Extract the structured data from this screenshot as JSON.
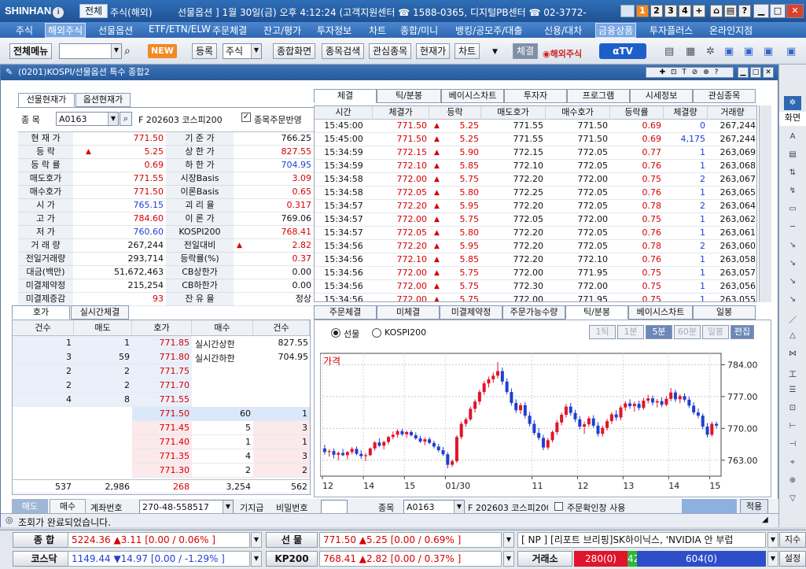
{
  "titlebar": {
    "logo": "SHINHAN",
    "btn_all": "전체",
    "btn_overseas": "주식(해외)",
    "marquee": "선물옵션 ] 1월 30일(금) 오후 4:12:24 (고객지원센터 ☎ 1588-0365, 디지털PB센터 ☎ 02-3772-",
    "nums": [
      "1",
      "2",
      "3",
      "4",
      "+"
    ]
  },
  "menubar": [
    "주식",
    "해외주식",
    "선물옵션",
    "ETF/ETN/ELW",
    "주문체결",
    "잔고/평가",
    "투자정보",
    "차트",
    "종합/미니",
    "뱅킹/공모주/대출",
    "신용/대차",
    "금융상품",
    "투자플러스",
    "온라인지점"
  ],
  "toolbar": {
    "menu_btn": "전체메뉴",
    "new_badge": "NEW",
    "register": "등록",
    "stock_select": "주식",
    "comprehensive": "종합화면",
    "stock_search": "종목검색",
    "interest": "관심종목",
    "current_price": "현재가",
    "chart": "차트",
    "execution": "체결",
    "overseas": "해외주식",
    "atv": "αTV"
  },
  "window": {
    "title": "(0201)KOSPI/선물옵션 특수 종합2"
  },
  "left_top": {
    "tabs": [
      "선물현재가",
      "옵션현재가"
    ],
    "code_label": "종 목",
    "code_value": "A0163",
    "code_name": "F 202603 코스피200",
    "check_label": "종목주문반영",
    "rows": [
      {
        "l1": "현 재 가",
        "v1": "771.50",
        "c1": "red",
        "l2": "기 준 가",
        "v2": "766.25",
        "c2": ""
      },
      {
        "l1": "등    락",
        "v1": "5.25",
        "c1": "red",
        "arrow": "▲",
        "l2": "상 한 가",
        "v2": "827.55",
        "c2": "red"
      },
      {
        "l1": "등 락 률",
        "v1": "0.69",
        "c1": "red",
        "l2": "하 한 가",
        "v2": "704.95",
        "c2": "blue"
      },
      {
        "l1": "매도호가",
        "v1": "771.55",
        "c1": "red",
        "l2": "시장Basis",
        "v2": "3.09",
        "c2": "red"
      },
      {
        "l1": "매수호가",
        "v1": "771.50",
        "c1": "red",
        "l2": "이론Basis",
        "v2": "0.65",
        "c2": "red"
      },
      {
        "l1": "시    가",
        "v1": "765.15",
        "c1": "blue",
        "l2": "괴 리 율",
        "v2": "0.317",
        "c2": "red"
      },
      {
        "l1": "고    가",
        "v1": "784.60",
        "c1": "red",
        "l2": "이 론 가",
        "v2": "769.06",
        "c2": ""
      },
      {
        "l1": "저    가",
        "v1": "760.60",
        "c1": "blue",
        "l2": "KOSPI200",
        "v2": "768.41",
        "c2": "red"
      },
      {
        "l1": "거 래 량",
        "v1": "267,244",
        "c1": "",
        "l2": "전일대비",
        "v2": "2.82",
        "c2": "red",
        "arrow2": "▲"
      },
      {
        "l1": "전일거래량",
        "v1": "293,714",
        "c1": "",
        "l2": "등락률(%)",
        "v2": "0.37",
        "c2": "red"
      },
      {
        "l1": "대금(백만)",
        "v1": "51,672,463",
        "c1": "",
        "l2": "CB상한가",
        "v2": "0.00",
        "c2": ""
      },
      {
        "l1": "미결제약정",
        "v1": "215,254",
        "c1": "",
        "l2": "CB하한가",
        "v2": "0.00",
        "c2": ""
      },
      {
        "l1": "미결제증감",
        "v1": "93",
        "c1": "red",
        "l2": "잔 유 율",
        "v2": "정상",
        "c2": ""
      }
    ]
  },
  "right_top": {
    "tabs": [
      "체결",
      "틱/분봉",
      "베이시스차트",
      "투자자",
      "프로그램",
      "시세정보",
      "관심종목"
    ],
    "headers": [
      "시간",
      "체결가",
      "등락",
      "매도호가",
      "매수호가",
      "등락률",
      "체결량",
      "거래량"
    ],
    "rows": [
      [
        "15:45:00",
        "771.50",
        "5.25",
        "771.55",
        "771.50",
        "0.69",
        "0",
        "267,244"
      ],
      [
        "15:45:00",
        "771.50",
        "5.25",
        "771.55",
        "771.50",
        "0.69",
        "4,175",
        "267,244"
      ],
      [
        "15:34:59",
        "772.15",
        "5.90",
        "772.15",
        "772.05",
        "0.77",
        "1",
        "263,069"
      ],
      [
        "15:34:59",
        "772.10",
        "5.85",
        "772.10",
        "772.05",
        "0.76",
        "1",
        "263,068"
      ],
      [
        "15:34:58",
        "772.00",
        "5.75",
        "772.20",
        "772.00",
        "0.75",
        "2",
        "263,067"
      ],
      [
        "15:34:58",
        "772.05",
        "5.80",
        "772.25",
        "772.05",
        "0.76",
        "1",
        "263,065"
      ],
      [
        "15:34:57",
        "772.20",
        "5.95",
        "772.20",
        "772.05",
        "0.78",
        "2",
        "263,064"
      ],
      [
        "15:34:57",
        "772.00",
        "5.75",
        "772.05",
        "772.00",
        "0.75",
        "1",
        "263,062"
      ],
      [
        "15:34:57",
        "772.05",
        "5.80",
        "772.20",
        "772.05",
        "0.76",
        "1",
        "263,061"
      ],
      [
        "15:34:56",
        "772.20",
        "5.95",
        "772.20",
        "772.05",
        "0.78",
        "2",
        "263,060"
      ],
      [
        "15:34:56",
        "772.10",
        "5.85",
        "772.20",
        "772.10",
        "0.76",
        "1",
        "263,058"
      ],
      [
        "15:34:56",
        "772.00",
        "5.75",
        "772.00",
        "771.95",
        "0.75",
        "1",
        "263,057"
      ],
      [
        "15:34:56",
        "772.00",
        "5.75",
        "772.30",
        "772.00",
        "0.75",
        "1",
        "263,056"
      ],
      [
        "15:34:56",
        "772.00",
        "5.75",
        "772.00",
        "771.95",
        "0.75",
        "1",
        "263,055"
      ]
    ]
  },
  "orderbook": {
    "tabs": [
      "호가",
      "실시간체결"
    ],
    "headers": [
      "건수",
      "매도",
      "호가",
      "매수",
      "건수"
    ],
    "asks": [
      {
        "cnt": "1",
        "qty": "1",
        "price": "771.85"
      },
      {
        "cnt": "3",
        "qty": "59",
        "price": "771.80"
      },
      {
        "cnt": "2",
        "qty": "2",
        "price": "771.75"
      },
      {
        "cnt": "2",
        "qty": "2",
        "price": "771.70"
      },
      {
        "cnt": "4",
        "qty": "8",
        "price": "771.55"
      }
    ],
    "upper_label": "실시간상한",
    "upper_val": "827.55",
    "lower_label": "실시간하한",
    "lower_val": "704.95",
    "bids": [
      {
        "price": "771.50",
        "qty": "60",
        "cnt": "1"
      },
      {
        "price": "771.45",
        "qty": "5",
        "cnt": "3"
      },
      {
        "price": "771.40",
        "qty": "1",
        "cnt": "1"
      },
      {
        "price": "771.35",
        "qty": "4",
        "cnt": "3"
      },
      {
        "price": "771.30",
        "qty": "2",
        "cnt": "2"
      }
    ],
    "totals": {
      "ask_cnt": "537",
      "ask_qty": "2,986",
      "diff": "268",
      "bid_qty": "3,254",
      "bid_cnt": "562"
    }
  },
  "order_strip": {
    "tab_sell": "매도",
    "tab_buy": "매수",
    "account_label": "계좌번호",
    "account": "270-48-558517",
    "general": "기지급",
    "password_label": "비밀번호",
    "code_label": "종목",
    "code": "A0163",
    "code_name": "F 202603 코스피200",
    "order_check": "주문확인창 사용",
    "apply": "적용"
  },
  "chart_panel": {
    "tabs": [
      "주문체결",
      "미체결",
      "미결제약정",
      "주문가능수량",
      "틱/분봉",
      "베이시스차트",
      "일봉"
    ],
    "radio1": "선물",
    "radio2": "KOSPI200",
    "btns": [
      "1틱",
      "1분",
      "5분",
      "60분",
      "일봉",
      "편집"
    ],
    "price_label": "가격"
  },
  "chart_data": {
    "type": "candlestick",
    "title": "",
    "price_label": "가격",
    "y_ticks": [
      784.0,
      777.0,
      770.0,
      763.0
    ],
    "ylim": [
      759.5,
      786.5
    ],
    "x_tick_labels": [
      "12",
      "14",
      "15",
      "01/30",
      "11",
      "12",
      "13",
      "14",
      "15"
    ],
    "candles": [
      [
        765.6,
        766.4,
        764.2,
        764.8
      ],
      [
        764.8,
        765.4,
        763.8,
        765.0
      ],
      [
        765.0,
        765.6,
        763.4,
        764.2
      ],
      [
        764.2,
        764.9,
        763.0,
        764.6
      ],
      [
        764.6,
        765.5,
        763.9,
        764.1
      ],
      [
        764.1,
        765.0,
        763.2,
        764.8
      ],
      [
        764.8,
        765.9,
        764.3,
        765.5
      ],
      [
        765.5,
        766.0,
        764.1,
        764.4
      ],
      [
        764.4,
        765.2,
        763.3,
        763.9
      ],
      [
        763.9,
        764.6,
        762.8,
        764.1
      ],
      [
        764.1,
        765.8,
        763.9,
        765.6
      ],
      [
        765.6,
        767.2,
        765.1,
        766.9
      ],
      [
        766.9,
        767.8,
        765.9,
        766.2
      ],
      [
        766.2,
        767.3,
        765.4,
        767.0
      ],
      [
        767.0,
        768.4,
        766.5,
        768.1
      ],
      [
        768.1,
        769.3,
        767.6,
        768.6
      ],
      [
        768.6,
        769.8,
        768.0,
        769.4
      ],
      [
        769.4,
        769.9,
        768.3,
        768.7
      ],
      [
        768.7,
        769.5,
        767.9,
        769.2
      ],
      [
        769.2,
        769.6,
        768.2,
        768.5
      ],
      [
        768.5,
        769.1,
        767.5,
        767.8
      ],
      [
        767.8,
        768.4,
        766.8,
        767.1
      ],
      [
        767.1,
        768.0,
        766.3,
        767.6
      ],
      [
        767.6,
        768.1,
        766.5,
        766.8
      ],
      [
        766.8,
        767.3,
        765.6,
        766.0
      ],
      [
        766.0,
        766.6,
        764.8,
        765.2
      ],
      [
        765.2,
        765.9,
        763.9,
        764.3
      ],
      [
        764.3,
        764.8,
        761.2,
        762.0
      ],
      [
        762.0,
        763.2,
        761.5,
        762.8
      ],
      [
        762.8,
        768.5,
        762.4,
        768.1
      ],
      [
        768.1,
        771.5,
        767.6,
        771.0
      ],
      [
        771.0,
        772.4,
        770.4,
        772.0
      ],
      [
        772.0,
        774.8,
        771.6,
        774.3
      ],
      [
        774.3,
        776.4,
        773.5,
        775.9
      ],
      [
        775.9,
        778.5,
        775.2,
        778.0
      ],
      [
        778.0,
        780.4,
        777.4,
        779.9
      ],
      [
        779.9,
        781.4,
        779.0,
        780.8
      ],
      [
        780.8,
        782.3,
        780.0,
        781.6
      ],
      [
        781.6,
        784.6,
        781.0,
        782.6
      ],
      [
        782.6,
        783.4,
        779.6,
        780.3
      ],
      [
        780.3,
        781.0,
        777.5,
        778.0
      ],
      [
        778.0,
        778.8,
        775.0,
        775.6
      ],
      [
        775.6,
        776.4,
        773.4,
        774.0
      ],
      [
        774.0,
        775.6,
        773.2,
        775.1
      ],
      [
        775.1,
        775.8,
        772.2,
        772.8
      ],
      [
        772.8,
        773.6,
        770.4,
        771.0
      ],
      [
        771.0,
        771.8,
        768.5,
        769.0
      ],
      [
        769.0,
        770.1,
        767.4,
        767.9
      ],
      [
        767.9,
        768.6,
        765.2,
        765.8
      ],
      [
        765.8,
        767.9,
        765.3,
        767.4
      ],
      [
        767.4,
        769.6,
        766.9,
        769.2
      ],
      [
        769.2,
        771.8,
        768.6,
        771.3
      ],
      [
        771.3,
        773.5,
        770.7,
        773.0
      ],
      [
        773.0,
        775.4,
        772.4,
        774.8
      ],
      [
        774.8,
        775.6,
        772.8,
        773.4
      ],
      [
        773.4,
        774.1,
        771.4,
        772.0
      ],
      [
        772.0,
        772.7,
        769.8,
        770.4
      ],
      [
        770.4,
        771.5,
        768.8,
        770.9
      ],
      [
        770.9,
        772.7,
        770.3,
        772.2
      ],
      [
        772.2,
        772.9,
        770.1,
        770.6
      ],
      [
        770.6,
        771.4,
        768.2,
        768.8
      ],
      [
        768.8,
        770.6,
        768.2,
        770.1
      ],
      [
        770.1,
        772.1,
        769.5,
        771.6
      ],
      [
        771.6,
        773.6,
        771.0,
        773.1
      ],
      [
        773.1,
        774.0,
        771.7,
        772.4
      ],
      [
        772.4,
        775.1,
        771.8,
        774.6
      ],
      [
        774.6,
        776.0,
        773.9,
        775.5
      ],
      [
        775.5,
        776.4,
        774.3,
        774.9
      ],
      [
        774.9,
        775.9,
        773.7,
        775.4
      ],
      [
        775.4,
        776.1,
        774.0,
        774.5
      ],
      [
        774.5,
        776.7,
        774.1,
        776.1
      ],
      [
        776.1,
        777.4,
        775.5,
        776.6
      ],
      [
        776.6,
        777.2,
        775.1,
        775.7
      ],
      [
        775.7,
        776.5,
        774.6,
        776.0
      ],
      [
        776.0,
        776.8,
        774.7,
        775.2
      ],
      [
        775.2,
        777.1,
        774.8,
        776.5
      ],
      [
        776.5,
        778.9,
        776.0,
        777.9
      ],
      [
        777.9,
        778.5,
        775.8,
        776.4
      ],
      [
        776.4,
        777.5,
        775.5,
        777.1
      ],
      [
        777.1,
        777.7,
        775.8,
        776.3
      ],
      [
        776.3,
        777.0,
        774.5,
        775.0
      ],
      [
        775.0,
        775.8,
        773.0,
        773.5
      ],
      [
        773.5,
        774.4,
        772.2,
        772.8
      ],
      [
        772.8,
        773.3,
        769.8,
        770.4
      ],
      [
        770.4,
        771.2,
        768.0,
        768.6
      ],
      [
        768.6,
        771.5,
        768.2,
        771.0
      ],
      [
        771.0,
        771.5,
        770.0,
        770.6
      ]
    ]
  },
  "statusbar": {
    "message": "조회가 완료되었습니다."
  },
  "ticker": {
    "r1": [
      {
        "label": "종  합",
        "value": "5224.36  ▲3.11   [0.00  / 0.06%  ]"
      },
      {
        "label": "선  물",
        "value": "771.50  ▲5.25   [0.00  / 0.69%  ]"
      },
      {
        "news": "[ NP ] [리포트 브리핑]SK하이닉스, 'NVIDIA 안 부럽"
      },
      {
        "btn": "지수"
      }
    ],
    "r2": [
      {
        "label": "코스닥",
        "value": "1149.44  ▼14.97  [0.00  / -1.29%  ]"
      },
      {
        "label": "KP200",
        "value": "768.41  ▲2.82   [0.00  / 0.37%  ]"
      },
      {
        "label": "거래소",
        "red": "280(0)",
        "green": "42",
        "blue": "604(0)"
      },
      {
        "btn": "설정"
      }
    ]
  }
}
